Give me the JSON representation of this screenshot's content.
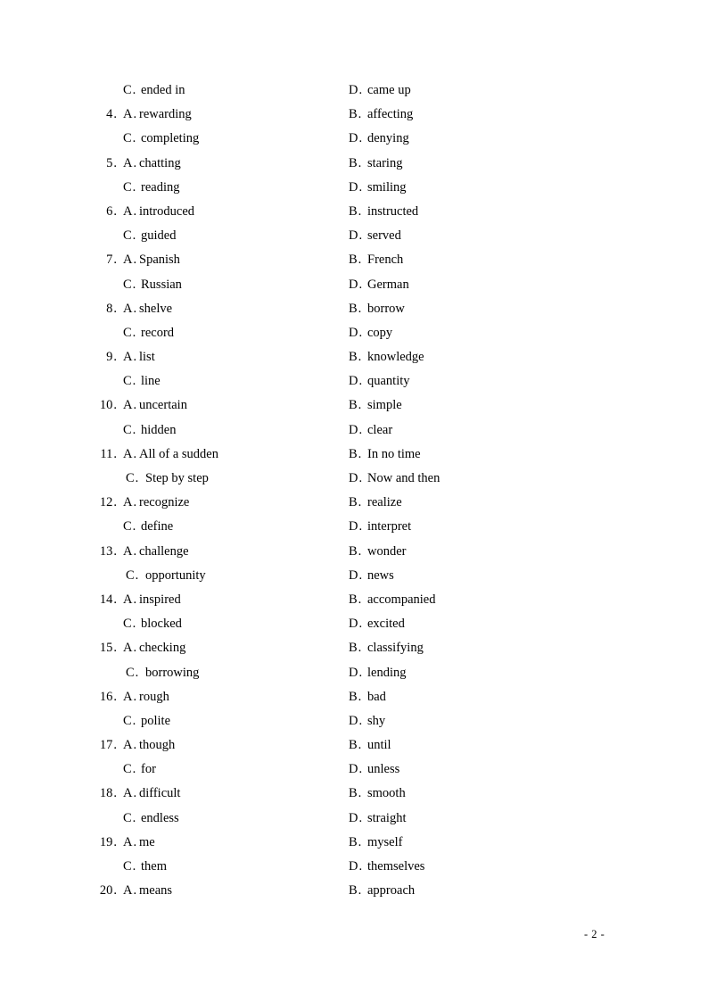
{
  "document": {
    "type": "exam-answer-options",
    "page_number_label": "- 2 -",
    "font_color": "#000000",
    "background_color": "#ffffff"
  },
  "rows": [
    {
      "number": "",
      "first_letter": "C",
      "first_text": "ended in",
      "second_letter": "D",
      "second_text": "came up",
      "is_second_row": true,
      "wide": false
    },
    {
      "number": "4",
      "first_letter": "A",
      "first_text": "rewarding",
      "second_letter": "B",
      "second_text": "affecting",
      "is_second_row": false,
      "wide": false
    },
    {
      "number": "",
      "first_letter": "C",
      "first_text": "completing",
      "second_letter": "D",
      "second_text": "denying",
      "is_second_row": true,
      "wide": false
    },
    {
      "number": "5",
      "first_letter": "A",
      "first_text": "chatting",
      "second_letter": "B",
      "second_text": "staring",
      "is_second_row": false,
      "wide": false
    },
    {
      "number": "",
      "first_letter": "C",
      "first_text": "reading",
      "second_letter": "D",
      "second_text": "smiling",
      "is_second_row": true,
      "wide": false
    },
    {
      "number": "6",
      "first_letter": "A",
      "first_text": "introduced",
      "second_letter": "B",
      "second_text": "instructed",
      "is_second_row": false,
      "wide": false
    },
    {
      "number": "",
      "first_letter": "C",
      "first_text": "guided",
      "second_letter": "D",
      "second_text": "served",
      "is_second_row": true,
      "wide": false
    },
    {
      "number": "7",
      "first_letter": "A",
      "first_text": "Spanish",
      "second_letter": "B",
      "second_text": "French",
      "is_second_row": false,
      "wide": false
    },
    {
      "number": "",
      "first_letter": "C",
      "first_text": "Russian",
      "second_letter": "D",
      "second_text": "German",
      "is_second_row": true,
      "wide": false
    },
    {
      "number": "8",
      "first_letter": "A",
      "first_text": "shelve",
      "second_letter": "B",
      "second_text": "borrow",
      "is_second_row": false,
      "wide": false
    },
    {
      "number": "",
      "first_letter": "C",
      "first_text": "record",
      "second_letter": "D",
      "second_text": "copy",
      "is_second_row": true,
      "wide": false
    },
    {
      "number": "9",
      "first_letter": "A",
      "first_text": "list",
      "second_letter": "B",
      "second_text": "knowledge",
      "is_second_row": false,
      "wide": false
    },
    {
      "number": "",
      "first_letter": "C",
      "first_text": "line",
      "second_letter": "D",
      "second_text": "quantity",
      "is_second_row": true,
      "wide": false
    },
    {
      "number": "10",
      "first_letter": "A",
      "first_text": "uncertain",
      "second_letter": "B",
      "second_text": "simple",
      "is_second_row": false,
      "wide": false
    },
    {
      "number": "",
      "first_letter": "C",
      "first_text": "hidden",
      "second_letter": "D",
      "second_text": "clear",
      "is_second_row": true,
      "wide": false
    },
    {
      "number": "11",
      "first_letter": "A",
      "first_text": "All of a sudden",
      "second_letter": "B",
      "second_text": "In no time",
      "is_second_row": false,
      "wide": false
    },
    {
      "number": "",
      "first_letter": "C",
      "first_text": "Step by step",
      "second_letter": "D",
      "second_text": "Now and then",
      "is_second_row": true,
      "wide": true
    },
    {
      "number": "12",
      "first_letter": "A",
      "first_text": "recognize",
      "second_letter": "B",
      "second_text": "realize",
      "is_second_row": false,
      "wide": false
    },
    {
      "number": "",
      "first_letter": "C",
      "first_text": "define",
      "second_letter": "D",
      "second_text": "interpret",
      "is_second_row": true,
      "wide": false
    },
    {
      "number": "13",
      "first_letter": "A",
      "first_text": "challenge",
      "second_letter": "B",
      "second_text": "wonder",
      "is_second_row": false,
      "wide": false
    },
    {
      "number": "",
      "first_letter": "C",
      "first_text": "opportunity",
      "second_letter": "D",
      "second_text": "news",
      "is_second_row": true,
      "wide": true
    },
    {
      "number": "14",
      "first_letter": "A",
      "first_text": "inspired",
      "second_letter": "B",
      "second_text": "accompanied",
      "is_second_row": false,
      "wide": false
    },
    {
      "number": "",
      "first_letter": "C",
      "first_text": "blocked",
      "second_letter": "D",
      "second_text": "excited",
      "is_second_row": true,
      "wide": false
    },
    {
      "number": "15",
      "first_letter": "A",
      "first_text": "checking",
      "second_letter": "B",
      "second_text": "classifying",
      "is_second_row": false,
      "wide": false
    },
    {
      "number": "",
      "first_letter": "C",
      "first_text": "borrowing",
      "second_letter": "D",
      "second_text": "lending",
      "is_second_row": true,
      "wide": true
    },
    {
      "number": "16",
      "first_letter": "A",
      "first_text": "rough",
      "second_letter": "B",
      "second_text": "bad",
      "is_second_row": false,
      "wide": false
    },
    {
      "number": "",
      "first_letter": "C",
      "first_text": "polite",
      "second_letter": "D",
      "second_text": "shy",
      "is_second_row": true,
      "wide": false
    },
    {
      "number": "17",
      "first_letter": "A",
      "first_text": "though",
      "second_letter": "B",
      "second_text": "until",
      "is_second_row": false,
      "wide": false
    },
    {
      "number": "",
      "first_letter": "C",
      "first_text": "for",
      "second_letter": "D",
      "second_text": "unless",
      "is_second_row": true,
      "wide": false
    },
    {
      "number": "18",
      "first_letter": "A",
      "first_text": "difficult",
      "second_letter": "B",
      "second_text": "smooth",
      "is_second_row": false,
      "wide": false
    },
    {
      "number": "",
      "first_letter": "C",
      "first_text": "endless",
      "second_letter": "D",
      "second_text": "straight",
      "is_second_row": true,
      "wide": false
    },
    {
      "number": "19",
      "first_letter": "A",
      "first_text": "me",
      "second_letter": "B",
      "second_text": "myself",
      "is_second_row": false,
      "wide": false
    },
    {
      "number": "",
      "first_letter": "C",
      "first_text": "them",
      "second_letter": "D",
      "second_text": "themselves",
      "is_second_row": true,
      "wide": false
    },
    {
      "number": "20",
      "first_letter": "A",
      "first_text": "means",
      "second_letter": "B",
      "second_text": "approach",
      "is_second_row": false,
      "wide": false
    }
  ]
}
